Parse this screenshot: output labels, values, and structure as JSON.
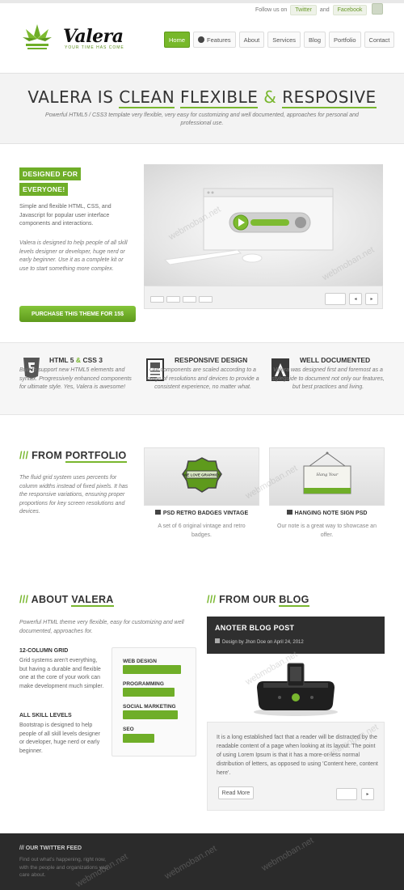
{
  "header": {
    "follow_text": "Follow us on",
    "twitter_label": "Twitter",
    "and_text": "and",
    "facebook_label": "Facebook",
    "logo_name": "Valera",
    "logo_tagline": "YOUR TIME HAS COME",
    "nav": [
      {
        "label": "Home",
        "active": true
      },
      {
        "label": "Features",
        "active": false
      },
      {
        "label": "About",
        "active": false
      },
      {
        "label": "Services",
        "active": false
      },
      {
        "label": "Blog",
        "active": false
      },
      {
        "label": "Portfolio",
        "active": false
      },
      {
        "label": "Contact",
        "active": false
      }
    ]
  },
  "hero": {
    "title_part1": "VALERA IS",
    "title_word1": "CLEAN",
    "title_word2": "FLEXIBLE",
    "title_amp": "&",
    "title_word3": "RESPOSIVE",
    "subtitle": "Powerful HTML5 / CSS3 template very flexible, very easy for customizing and well documented, approaches for personal and professional use."
  },
  "intro": {
    "badge_line1": "DESIGNED FOR",
    "badge_line2": "EVERYONE!",
    "text1": "Simple and flexible HTML, CSS, and Javascript for popular user interface components and interactions.",
    "text2": "Valera is designed to help people of all skill levels designer or developer, huge nerd or early beginner. Use it as a complete kit or use to start something more complex.",
    "purchase_button": "PURCHASE THIS THEME FOR 15$"
  },
  "features": [
    {
      "title_a": "HTML 5",
      "title_amp": "&",
      "title_b": "CSS 3",
      "text": "Built to support new HTML5 elements and syntax. Progressively enhanced components for ultimate style. Yes, Valera is awesome!",
      "icon": "html5-icon"
    },
    {
      "title": "RESPONSIVE DESIGN",
      "text": "Our components are scaled according to a range of resolutions and devices to provide a consistent experience, no matter what.",
      "icon": "document-icon"
    },
    {
      "title": "WELL DOCUMENTED",
      "text": "Valera was designed first and foremost as a styleguide to document not only our features, but best practices and living.",
      "icon": "adobe-icon"
    }
  ],
  "portfolio": {
    "title_prefix": "///",
    "title_from": "FROM",
    "title_word": "PORTFOLIO",
    "text": "The fluid grid system uses percents for column widths instead of fixed pixels. It has the responsive variations, ensuring proper proportions for key screen resolutions and devices.",
    "items": [
      {
        "caption": "PSD RETRO BADGES VINTAGE",
        "text": "A set of 6 original vintage and retro badges.",
        "badge_text": "WE LOVE GRAPHICS"
      },
      {
        "caption": "HANGING NOTE SIGN PSD",
        "text": "Our note is a great way to showcase an offer.",
        "sign_text": "Hang Your"
      }
    ]
  },
  "about": {
    "title_prefix": "///",
    "title_about": "ABOUT",
    "title_word": "VALERA",
    "text": "Powerful HTML theme very flexible, easy for customizing and well documented, approaches for.",
    "grid_title": "12-COLUMN GRID",
    "grid_text": "Grid systems aren't everything, but having a durable and flexible one at the core of your work can make development much simpler.",
    "levels_title": "ALL SKILL LEVELS",
    "levels_text": "Bootstrap is designed to help people of all skill levels designer or developer, huge nerd or early beginner.",
    "skills": [
      {
        "label": "WEB DESIGN",
        "level": 0.9
      },
      {
        "label": "PROGRAMMING",
        "level": 0.8
      },
      {
        "label": "SOCIAL MARKETING",
        "level": 0.85
      },
      {
        "label": "SEO",
        "level": 0.48
      }
    ]
  },
  "blog": {
    "title_prefix": "///",
    "title_from": "FROM OUR",
    "title_word": "BLOG",
    "post_title": "ANOTER BLOG POST",
    "meta": "Design by Jhon Doe on April 24, 2012",
    "text": "It is a long established fact that a reader will be distracted by the readable content of a page when looking at its layout. The point of using Lorem Ipsum is that it has a more-or-less normal distribution of letters, as opposed to using 'Content here, content here'.",
    "read_more": "Read More"
  },
  "footer": {
    "twitter_title": "/// OUR TWITTER FEED",
    "twitter_text": "Find out what's happening, right now, with the people and organizations you care about."
  },
  "watermark": "webmoban.net"
}
